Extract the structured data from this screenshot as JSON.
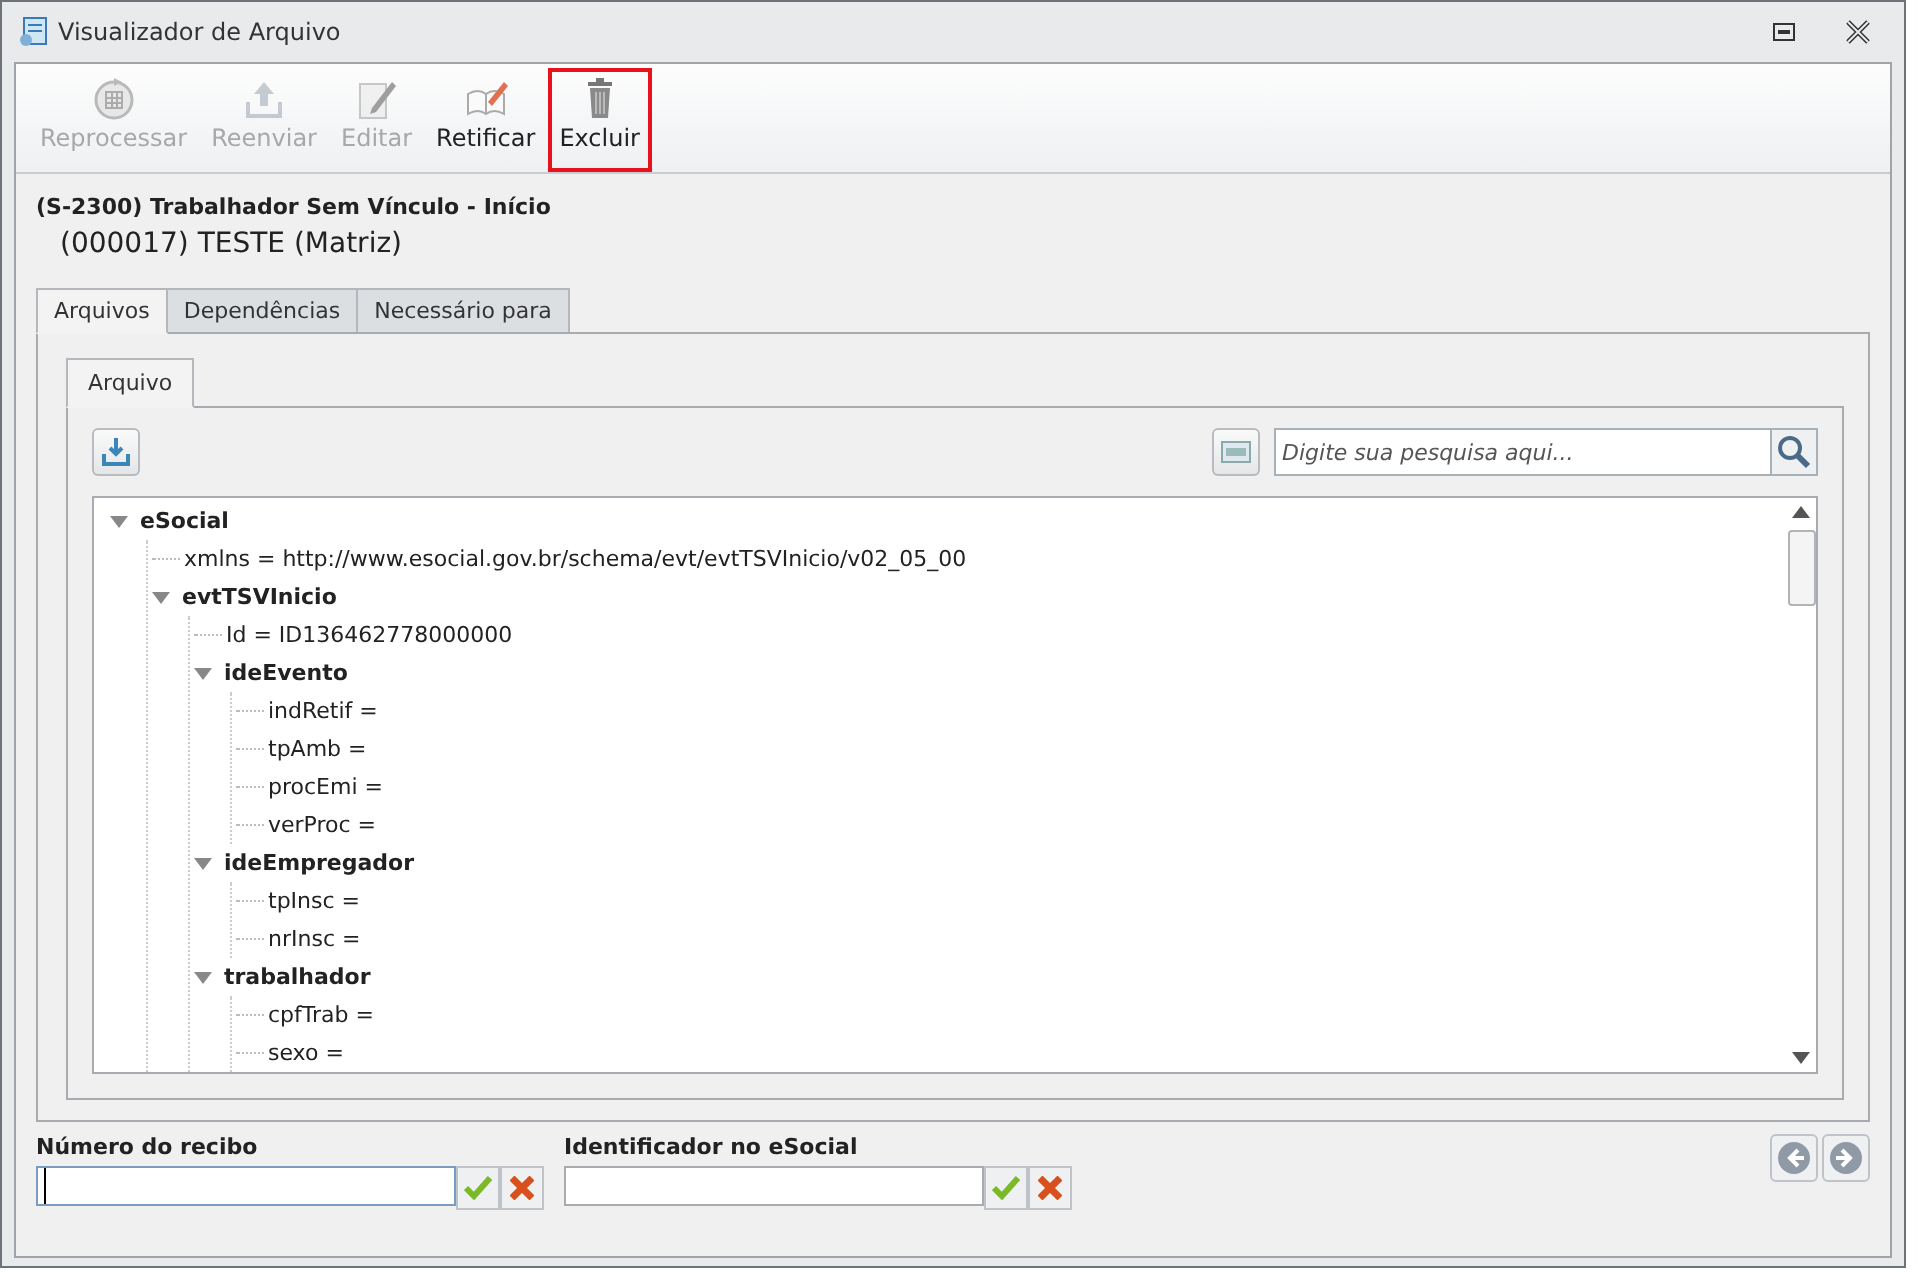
{
  "window": {
    "title": "Visualizador de Arquivo"
  },
  "toolbar": [
    {
      "kind": "reprocess",
      "label": "Reprocessar",
      "disabled": true,
      "highlighted": false
    },
    {
      "kind": "upload",
      "label": "Reenviar",
      "disabled": true,
      "highlighted": false
    },
    {
      "kind": "edit",
      "label": "Editar",
      "disabled": true,
      "highlighted": false
    },
    {
      "kind": "rectify",
      "label": "Retificar",
      "disabled": false,
      "highlighted": false
    },
    {
      "kind": "delete",
      "label": "Excluir",
      "disabled": false,
      "highlighted": true
    }
  ],
  "event_title": "(S-2300) Trabalhador Sem Vínculo - Início",
  "company": "(000017) TESTE (Matriz)",
  "tabs": [
    {
      "label": "Arquivos",
      "selected": true
    },
    {
      "label": "Dependências",
      "selected": false
    },
    {
      "label": "Necessário para",
      "selected": false
    }
  ],
  "inner_tabs": [
    {
      "label": "Arquivo",
      "selected": true
    }
  ],
  "search": {
    "placeholder": "Digite sua pesquisa aqui..."
  },
  "tree": [
    {
      "kind": "element",
      "label": "eSocial",
      "expanded": true,
      "children": [
        {
          "kind": "attribute",
          "label": "xmlns = http://www.esocial.gov.br/schema/evt/evtTSVInicio/v02_05_00"
        },
        {
          "kind": "element",
          "label": "evtTSVInicio",
          "expanded": true,
          "children": [
            {
              "kind": "attribute",
              "label": "Id = ID136462778000000"
            },
            {
              "kind": "element",
              "label": "ideEvento",
              "expanded": true,
              "children": [
                {
                  "kind": "attribute",
                  "label": "indRetif ="
                },
                {
                  "kind": "attribute",
                  "label": "tpAmb ="
                },
                {
                  "kind": "attribute",
                  "label": "procEmi ="
                },
                {
                  "kind": "attribute",
                  "label": "verProc ="
                }
              ]
            },
            {
              "kind": "element",
              "label": "ideEmpregador",
              "expanded": true,
              "children": [
                {
                  "kind": "attribute",
                  "label": "tpInsc ="
                },
                {
                  "kind": "attribute",
                  "label": "nrInsc ="
                }
              ]
            },
            {
              "kind": "element",
              "label": "trabalhador",
              "expanded": true,
              "children": [
                {
                  "kind": "attribute",
                  "label": "cpfTrab ="
                },
                {
                  "kind": "attribute",
                  "label": "sexo ="
                }
              ]
            }
          ]
        }
      ]
    }
  ],
  "fields": [
    {
      "label": "Número do recibo",
      "focused": true
    },
    {
      "label": "Identificador no eSocial",
      "focused": false
    }
  ]
}
